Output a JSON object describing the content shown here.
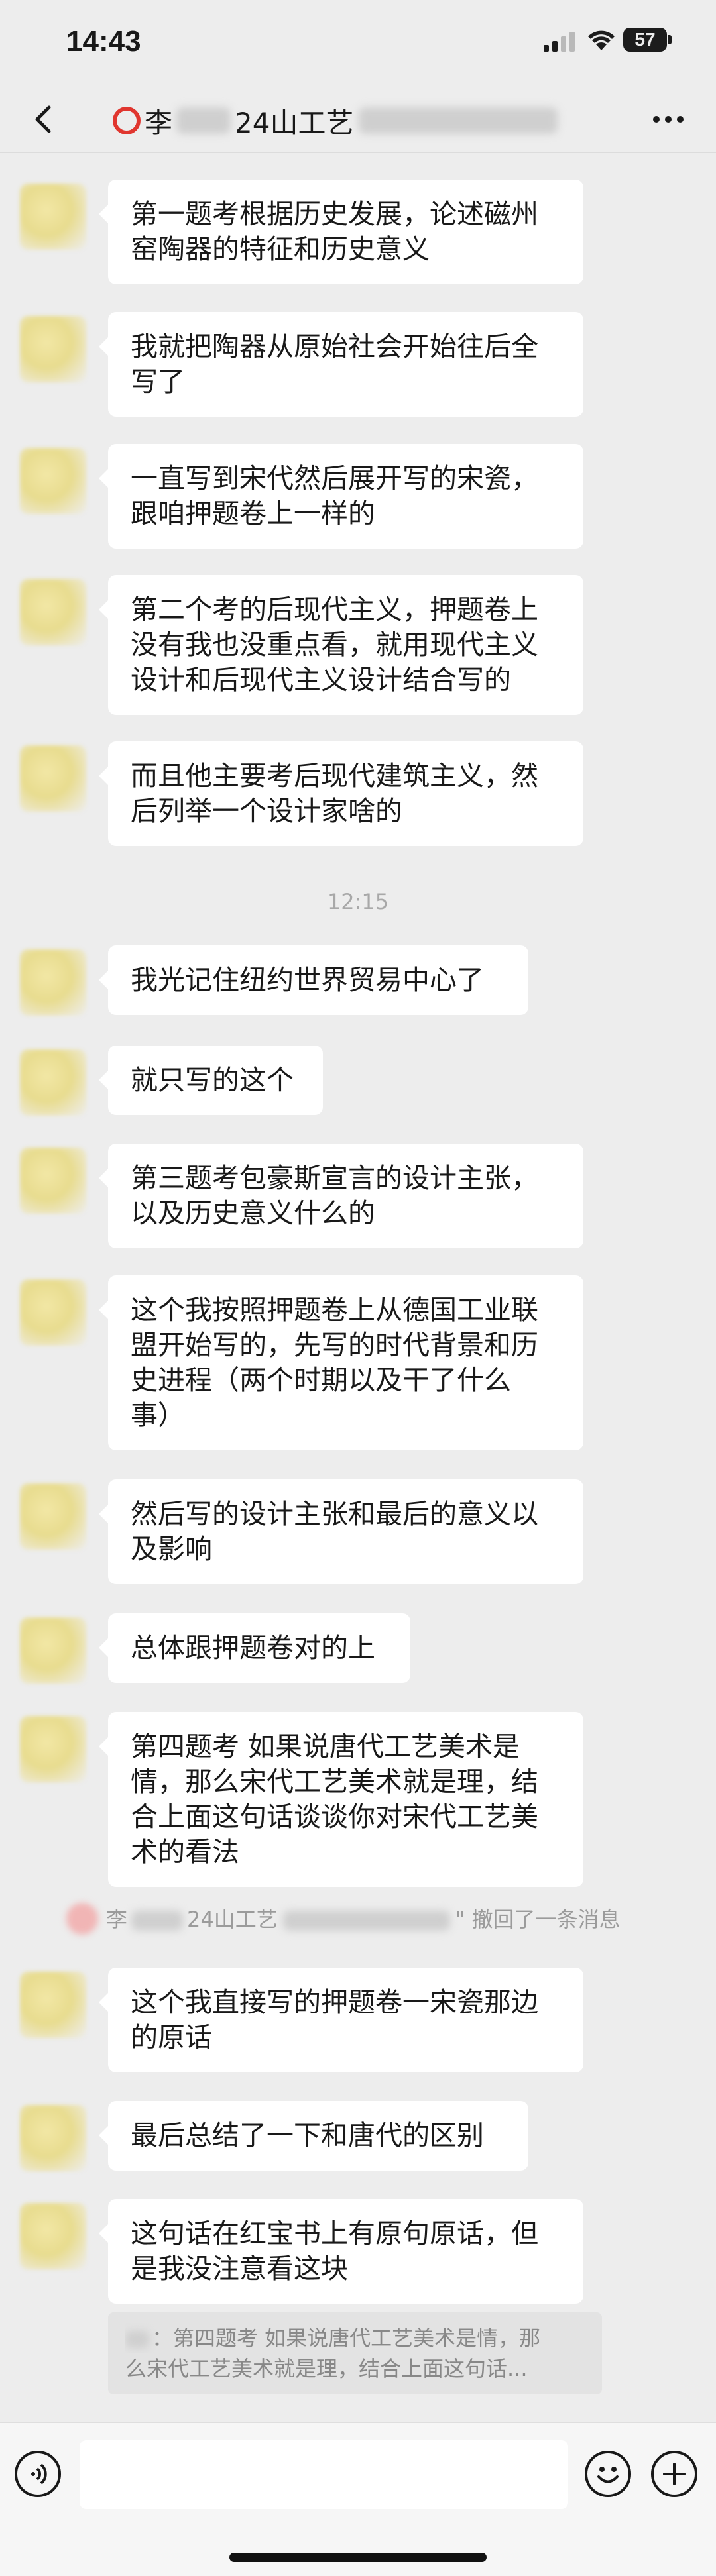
{
  "status_bar": {
    "time": "14:43",
    "battery": "57"
  },
  "header": {
    "title_prefix": "李",
    "title_middle": "24山工艺",
    "back_icon": "chevron-left-icon",
    "more_icon": "ellipsis-icon"
  },
  "messages": [
    {
      "text": "第一题考根据历史发展，论述磁州\n窑陶器的特征和历史意义"
    },
    {
      "text": "我就把陶器从原始社会开始往后全\n写了"
    },
    {
      "text": "一直写到宋代然后展开写的宋瓷，\n跟咱押题卷上一样的"
    },
    {
      "text": "第二个考的后现代主义，押题卷上\n没有我也没重点看，就用现代主义\n设计和后现代主义设计结合写的"
    },
    {
      "text": "而且他主要考后现代建筑主义，然\n后列举一个设计家啥的"
    },
    {
      "text": "我光记住纽约世界贸易中心了"
    },
    {
      "text": "就只写的这个"
    },
    {
      "text": "第三题考包豪斯宣言的设计主张，\n以及历史意义什么的"
    },
    {
      "text": "这个我按照押题卷上从德国工业联\n盟开始写的，先写的时代背景和历\n史进程（两个时期以及干了什么\n事）"
    },
    {
      "text": "然后写的设计主张和最后的意义以\n及影响"
    },
    {
      "text": "总体跟押题卷对的上"
    },
    {
      "text": "第四题考 如果说唐代工艺美术是\n情，那么宋代工艺美术就是理，结\n合上面这句话谈谈你对宋代工艺美\n术的看法"
    },
    {
      "text": "这个我直接写的押题卷一宋瓷那边\n的原话"
    },
    {
      "text": "最后总结了一下和唐代的区别"
    },
    {
      "text": "这句话在红宝书上有原句原话，但\n是我没注意看这块"
    }
  ],
  "time_divider": "12:15",
  "recall_notice": {
    "name_prefix": "李",
    "name_middle": "24山工艺",
    "suffix": "\" 撤回了一条消息"
  },
  "quote": {
    "line1": "：第四题考 如果说唐代工艺美术是情，那",
    "line2": "么宋代工艺美术就是理，结合上面这句话..."
  },
  "input_bar": {
    "voice_icon": "voice-icon",
    "emoji_icon": "emoji-icon",
    "plus_icon": "plus-circle-icon"
  }
}
